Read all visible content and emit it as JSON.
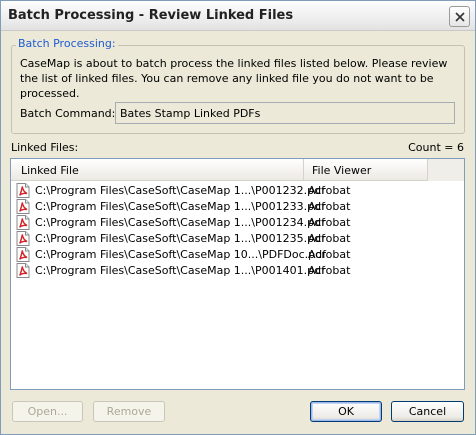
{
  "window": {
    "title": "Batch Processing - Review Linked Files",
    "close_icon": "close-icon"
  },
  "group": {
    "legend": "Batch Processing:",
    "description": "CaseMap is about to batch process the linked files listed below.  Please review the list of linked files.  You can remove any linked file you do not want to be processed.",
    "batch_command_label": "Batch Command:",
    "batch_command_value": "Bates Stamp Linked PDFs"
  },
  "linked_files": {
    "label": "Linked Files:",
    "count": "Count = 6",
    "columns": [
      "Linked File",
      "File Viewer",
      ""
    ],
    "rows": [
      {
        "path": "C:\\Program Files\\CaseSoft\\CaseMap 1...\\P001232.pdf",
        "viewer": "Acrobat",
        "icon": "pdf-icon"
      },
      {
        "path": "C:\\Program Files\\CaseSoft\\CaseMap 1...\\P001233.pdf",
        "viewer": "Acrobat",
        "icon": "pdf-icon"
      },
      {
        "path": "C:\\Program Files\\CaseSoft\\CaseMap 1...\\P001234.pdf",
        "viewer": "Acrobat",
        "icon": "pdf-icon"
      },
      {
        "path": "C:\\Program Files\\CaseSoft\\CaseMap 1...\\P001235.pdf",
        "viewer": "Acrobat",
        "icon": "pdf-icon"
      },
      {
        "path": "C:\\Program Files\\CaseSoft\\CaseMap 10...\\PDFDoc.pdf",
        "viewer": "Acrobat",
        "icon": "pdf-icon"
      },
      {
        "path": "C:\\Program Files\\CaseSoft\\CaseMap 1...\\P001401.pdf",
        "viewer": "Acrobat",
        "icon": "pdf-icon"
      }
    ]
  },
  "buttons": {
    "open": "Open...",
    "remove": "Remove",
    "ok": "OK",
    "cancel": "Cancel"
  },
  "colors": {
    "legend": "#1e5bd1",
    "dialog_bg": "#ece9d8",
    "pdf_red": "#d2232a"
  }
}
